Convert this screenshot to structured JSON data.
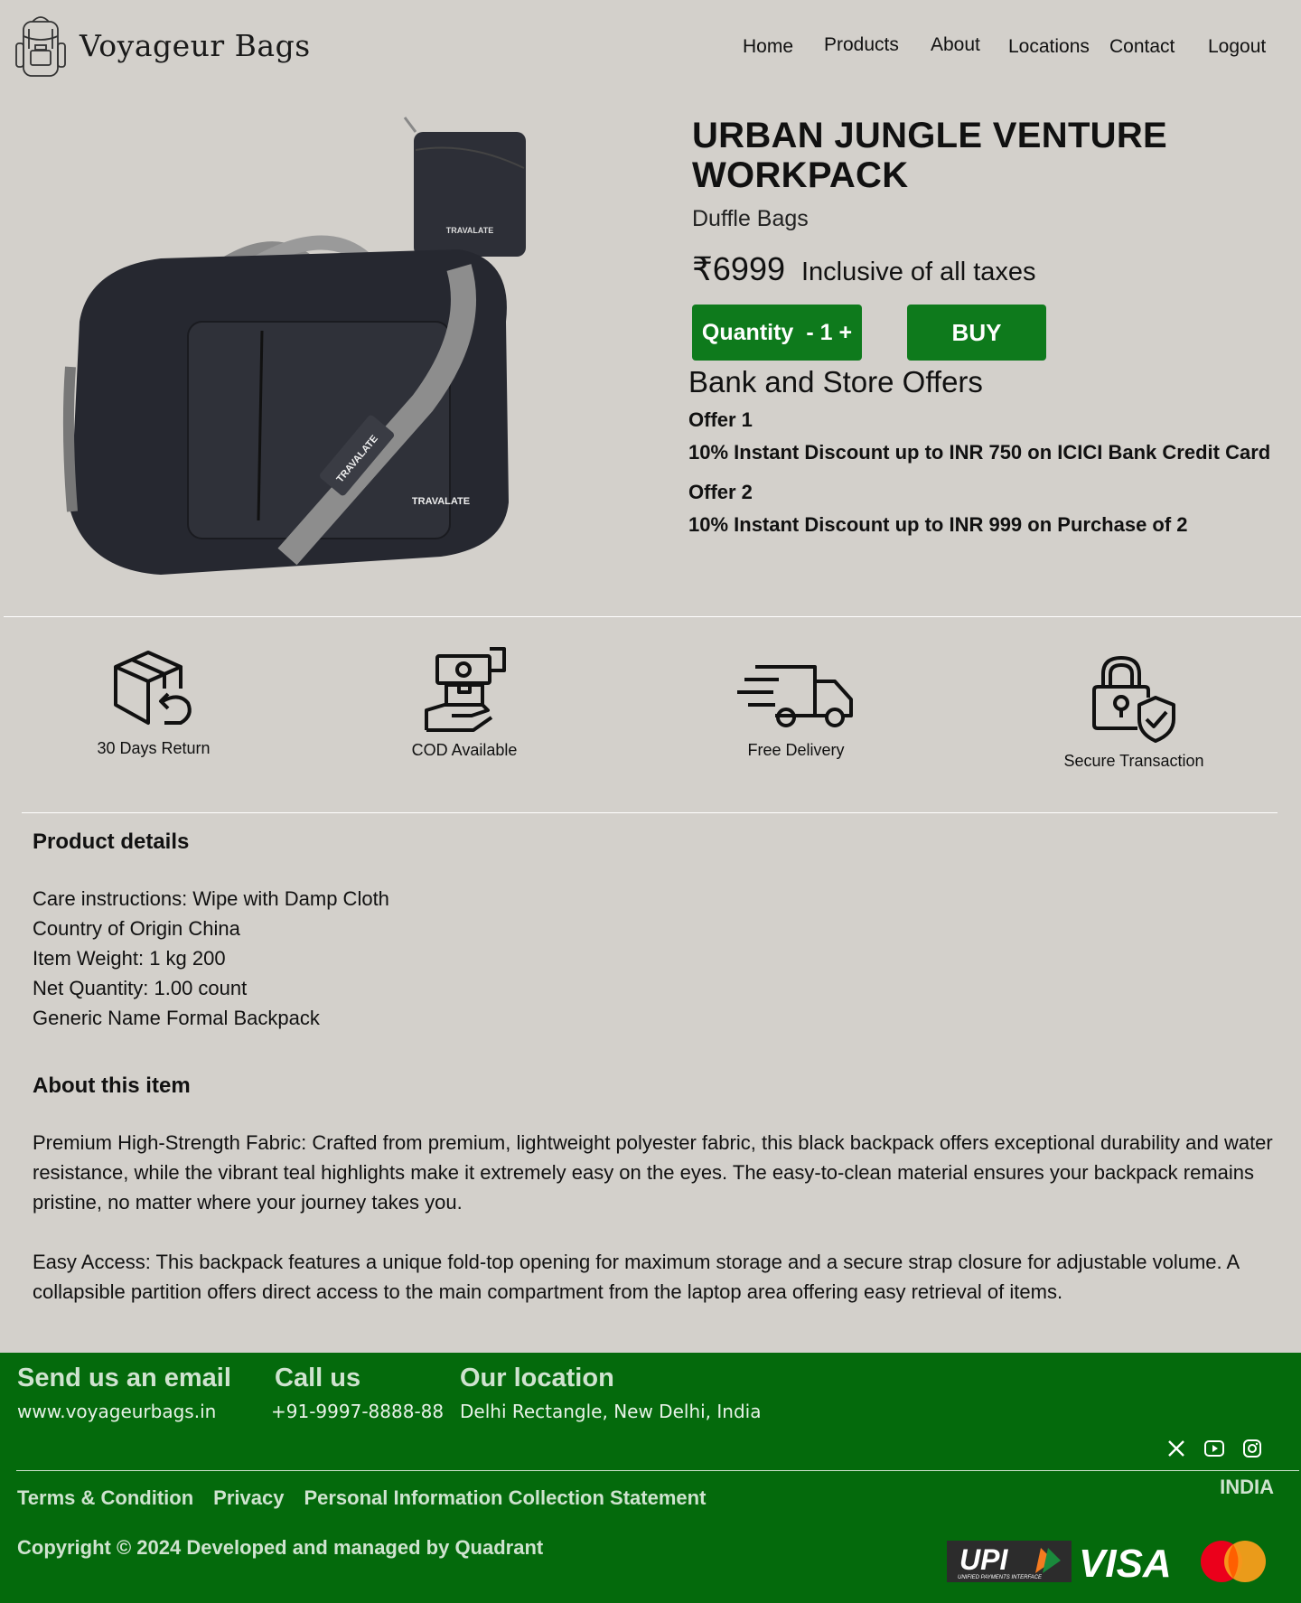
{
  "header": {
    "brand": "Voyageur Bags",
    "nav": [
      "Home",
      "Products",
      "About",
      "Locations",
      "Contact",
      "Logout"
    ]
  },
  "product": {
    "title": "URBAN JUNGLE VENTURE WORKPACK",
    "category": "Duffle Bags",
    "price": "₹6999",
    "tax_note": "Inclusive of all taxes",
    "quantity_label": "Quantity",
    "quantity_value": "- 1 +",
    "buy_label": "BUY",
    "image_brand": "TRAVALATE"
  },
  "offers": {
    "heading": "Bank and Store Offers",
    "items": [
      {
        "label": "Offer 1",
        "text": "10% Instant Discount up to INR 750 on ICICI Bank Credit Card"
      },
      {
        "label": "Offer 2",
        "text": "10% Instant Discount up to INR 999 on Purchase of 2"
      }
    ]
  },
  "features": [
    {
      "label": "30 Days Return",
      "icon": "return-box-icon"
    },
    {
      "label": "COD Available",
      "icon": "cash-hand-icon"
    },
    {
      "label": "Free Delivery",
      "icon": "delivery-truck-icon"
    },
    {
      "label": "Secure Transaction",
      "icon": "secure-lock-icon"
    }
  ],
  "details": {
    "heading": "Product details",
    "lines": [
      "Care instructions: Wipe with Damp Cloth",
      "Country of Origin China",
      "Item Weight: 1 kg 200",
      "Net Quantity: 1.00 count",
      "Generic Name Formal Backpack"
    ]
  },
  "about": {
    "heading": "About this item",
    "paragraphs": [
      "Premium High-Strength Fabric: Crafted from premium, lightweight polyester fabric, this black backpack offers exceptional durability and water resistance, while the vibrant teal highlights make it extremely easy on the eyes. The easy-to-clean material ensures your backpack remains pristine, no matter where your journey takes you.",
      "Easy Access: This backpack features a unique fold-top opening for maximum storage and a secure strap closure for adjustable volume. A collapsible partition offers direct access to the main compartment from the laptop area offering easy retrieval of items."
    ]
  },
  "footer": {
    "email_heading": "Send us an email",
    "email_value": "www.voyageurbags.in",
    "call_heading": "Call us",
    "call_value": "+91-9997-8888-88",
    "location_heading": "Our location",
    "location_value": "Delhi Rectangle, New Delhi, India",
    "social": [
      "x-icon",
      "youtube-icon",
      "instagram-icon"
    ],
    "country": "INDIA",
    "links": [
      "Terms & Condition",
      "Privacy",
      "Personal Information Collection Statement"
    ],
    "copyright": "Copyright © 2024 Developed and managed by Quadrant",
    "payments": {
      "upi": "UPI",
      "upi_sub": "UNIFIED PAYMENTS INTERFACE",
      "visa": "VISA",
      "mastercard": "mastercard-logo"
    }
  },
  "colors": {
    "background": "#d3d0cb",
    "accent_green": "#0e7a1c",
    "footer_green": "#046a0c"
  }
}
